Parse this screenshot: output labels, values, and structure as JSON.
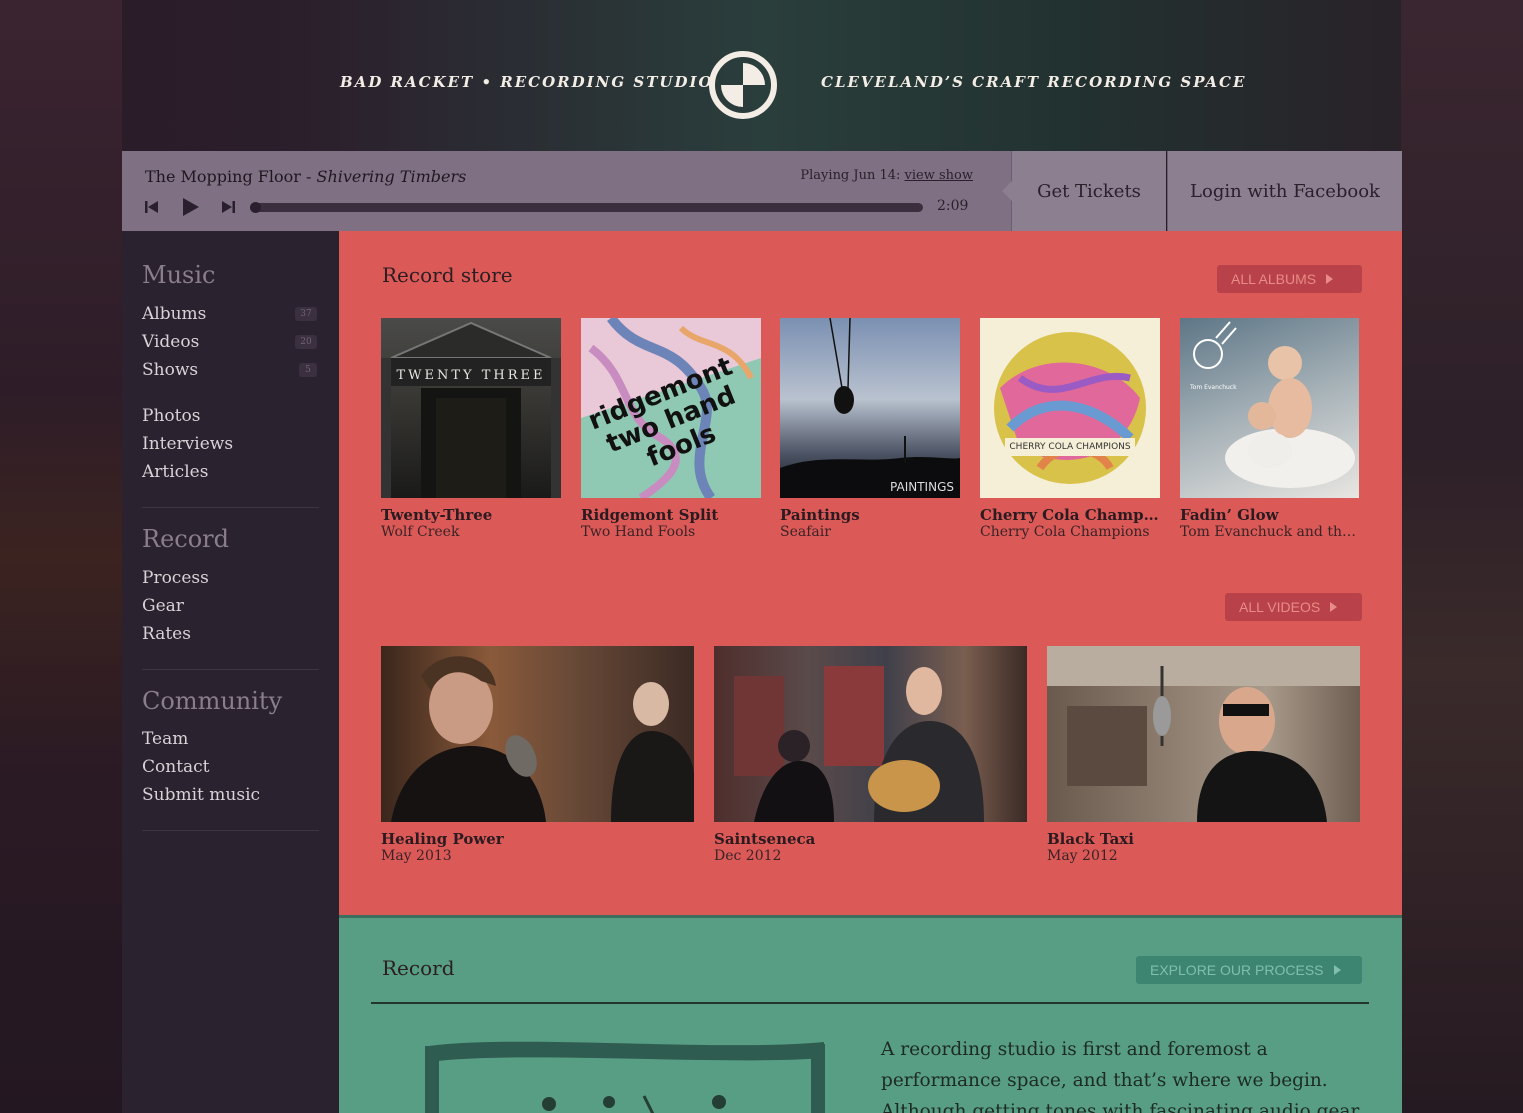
{
  "header": {
    "left_tagline": "BAD RACKET • RECORDING STUDIO",
    "right_tagline": "CLEVELAND’S CRAFT RECORDING SPACE"
  },
  "player": {
    "artist": "The Mopping Floor",
    "separator": " - ",
    "song": "Shivering Timbers",
    "playing_label": "Playing Jun 14: ",
    "show_link": "view show",
    "time": "2:09",
    "progress": 0
  },
  "nav": {
    "tickets": "Get Tickets",
    "facebook": "Login with Facebook"
  },
  "sidebar": {
    "music_heading": "Music",
    "music_items": [
      {
        "label": "Albums",
        "count": "37"
      },
      {
        "label": "Videos",
        "count": "20"
      },
      {
        "label": "Shows",
        "count": "5"
      }
    ],
    "music_extra": [
      "Photos",
      "Interviews",
      "Articles"
    ],
    "record_heading": "Record",
    "record_items": [
      "Process",
      "Gear",
      "Rates"
    ],
    "community_heading": "Community",
    "community_items": [
      "Team",
      "Contact",
      "Submit music"
    ]
  },
  "store": {
    "title": "Record store",
    "all_albums": "ALL ALBUMS",
    "all_videos": "ALL VIDEOS",
    "albums": [
      {
        "title": "Twenty-Three",
        "artist": "Wolf Creek",
        "cover_text": "TWENTY THREE"
      },
      {
        "title": "Ridgemont Split",
        "artist": "Two Hand Fools",
        "cover_text": "ridgemont two hand fools"
      },
      {
        "title": "Paintings",
        "artist": "Seafair",
        "cover_text": "PAINTINGS"
      },
      {
        "title": "Cherry Cola Champi...",
        "artist": "Cherry Cola Champions",
        "cover_text": "CHERRY COLA CHAMPIONS"
      },
      {
        "title": "Fadin’ Glow",
        "artist": "Tom Evanchuck and the ...",
        "cover_text": "Tom Evanchuck"
      }
    ],
    "videos": [
      {
        "title": "Healing Power",
        "date": "May 2013"
      },
      {
        "title": "Saintseneca",
        "date": "Dec 2012"
      },
      {
        "title": "Black Taxi",
        "date": "May 2012"
      }
    ]
  },
  "record": {
    "title": "Record",
    "button": "EXPLORE OUR PROCESS",
    "text": "A recording studio is first and foremost a performance space, and that’s where we begin. Although getting tones with fascinating audio gear and tweaking levels to"
  },
  "colors": {
    "store_bg": "#db5a57",
    "record_bg": "#579e85",
    "sidebar_bg": "#2a222e",
    "player_bg": "#7f7183"
  }
}
